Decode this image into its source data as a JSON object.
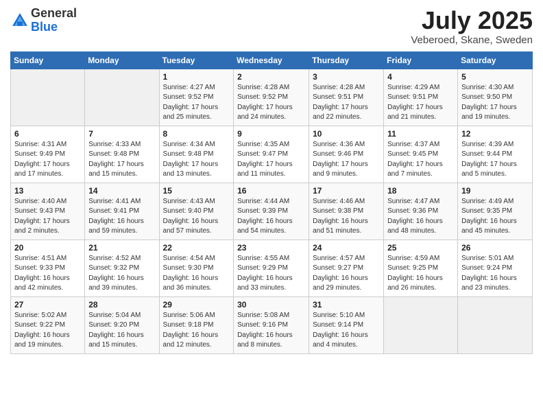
{
  "header": {
    "logo_line1": "General",
    "logo_line2": "Blue",
    "month": "July 2025",
    "location": "Veberoed, Skane, Sweden"
  },
  "weekdays": [
    "Sunday",
    "Monday",
    "Tuesday",
    "Wednesday",
    "Thursday",
    "Friday",
    "Saturday"
  ],
  "weeks": [
    [
      {
        "day": null
      },
      {
        "day": null
      },
      {
        "day": "1",
        "sunrise": "Sunrise: 4:27 AM",
        "sunset": "Sunset: 9:52 PM",
        "daylight": "Daylight: 17 hours and 25 minutes."
      },
      {
        "day": "2",
        "sunrise": "Sunrise: 4:28 AM",
        "sunset": "Sunset: 9:52 PM",
        "daylight": "Daylight: 17 hours and 24 minutes."
      },
      {
        "day": "3",
        "sunrise": "Sunrise: 4:28 AM",
        "sunset": "Sunset: 9:51 PM",
        "daylight": "Daylight: 17 hours and 22 minutes."
      },
      {
        "day": "4",
        "sunrise": "Sunrise: 4:29 AM",
        "sunset": "Sunset: 9:51 PM",
        "daylight": "Daylight: 17 hours and 21 minutes."
      },
      {
        "day": "5",
        "sunrise": "Sunrise: 4:30 AM",
        "sunset": "Sunset: 9:50 PM",
        "daylight": "Daylight: 17 hours and 19 minutes."
      }
    ],
    [
      {
        "day": "6",
        "sunrise": "Sunrise: 4:31 AM",
        "sunset": "Sunset: 9:49 PM",
        "daylight": "Daylight: 17 hours and 17 minutes."
      },
      {
        "day": "7",
        "sunrise": "Sunrise: 4:33 AM",
        "sunset": "Sunset: 9:48 PM",
        "daylight": "Daylight: 17 hours and 15 minutes."
      },
      {
        "day": "8",
        "sunrise": "Sunrise: 4:34 AM",
        "sunset": "Sunset: 9:48 PM",
        "daylight": "Daylight: 17 hours and 13 minutes."
      },
      {
        "day": "9",
        "sunrise": "Sunrise: 4:35 AM",
        "sunset": "Sunset: 9:47 PM",
        "daylight": "Daylight: 17 hours and 11 minutes."
      },
      {
        "day": "10",
        "sunrise": "Sunrise: 4:36 AM",
        "sunset": "Sunset: 9:46 PM",
        "daylight": "Daylight: 17 hours and 9 minutes."
      },
      {
        "day": "11",
        "sunrise": "Sunrise: 4:37 AM",
        "sunset": "Sunset: 9:45 PM",
        "daylight": "Daylight: 17 hours and 7 minutes."
      },
      {
        "day": "12",
        "sunrise": "Sunrise: 4:39 AM",
        "sunset": "Sunset: 9:44 PM",
        "daylight": "Daylight: 17 hours and 5 minutes."
      }
    ],
    [
      {
        "day": "13",
        "sunrise": "Sunrise: 4:40 AM",
        "sunset": "Sunset: 9:43 PM",
        "daylight": "Daylight: 17 hours and 2 minutes."
      },
      {
        "day": "14",
        "sunrise": "Sunrise: 4:41 AM",
        "sunset": "Sunset: 9:41 PM",
        "daylight": "Daylight: 16 hours and 59 minutes."
      },
      {
        "day": "15",
        "sunrise": "Sunrise: 4:43 AM",
        "sunset": "Sunset: 9:40 PM",
        "daylight": "Daylight: 16 hours and 57 minutes."
      },
      {
        "day": "16",
        "sunrise": "Sunrise: 4:44 AM",
        "sunset": "Sunset: 9:39 PM",
        "daylight": "Daylight: 16 hours and 54 minutes."
      },
      {
        "day": "17",
        "sunrise": "Sunrise: 4:46 AM",
        "sunset": "Sunset: 9:38 PM",
        "daylight": "Daylight: 16 hours and 51 minutes."
      },
      {
        "day": "18",
        "sunrise": "Sunrise: 4:47 AM",
        "sunset": "Sunset: 9:36 PM",
        "daylight": "Daylight: 16 hours and 48 minutes."
      },
      {
        "day": "19",
        "sunrise": "Sunrise: 4:49 AM",
        "sunset": "Sunset: 9:35 PM",
        "daylight": "Daylight: 16 hours and 45 minutes."
      }
    ],
    [
      {
        "day": "20",
        "sunrise": "Sunrise: 4:51 AM",
        "sunset": "Sunset: 9:33 PM",
        "daylight": "Daylight: 16 hours and 42 minutes."
      },
      {
        "day": "21",
        "sunrise": "Sunrise: 4:52 AM",
        "sunset": "Sunset: 9:32 PM",
        "daylight": "Daylight: 16 hours and 39 minutes."
      },
      {
        "day": "22",
        "sunrise": "Sunrise: 4:54 AM",
        "sunset": "Sunset: 9:30 PM",
        "daylight": "Daylight: 16 hours and 36 minutes."
      },
      {
        "day": "23",
        "sunrise": "Sunrise: 4:55 AM",
        "sunset": "Sunset: 9:29 PM",
        "daylight": "Daylight: 16 hours and 33 minutes."
      },
      {
        "day": "24",
        "sunrise": "Sunrise: 4:57 AM",
        "sunset": "Sunset: 9:27 PM",
        "daylight": "Daylight: 16 hours and 29 minutes."
      },
      {
        "day": "25",
        "sunrise": "Sunrise: 4:59 AM",
        "sunset": "Sunset: 9:25 PM",
        "daylight": "Daylight: 16 hours and 26 minutes."
      },
      {
        "day": "26",
        "sunrise": "Sunrise: 5:01 AM",
        "sunset": "Sunset: 9:24 PM",
        "daylight": "Daylight: 16 hours and 23 minutes."
      }
    ],
    [
      {
        "day": "27",
        "sunrise": "Sunrise: 5:02 AM",
        "sunset": "Sunset: 9:22 PM",
        "daylight": "Daylight: 16 hours and 19 minutes."
      },
      {
        "day": "28",
        "sunrise": "Sunrise: 5:04 AM",
        "sunset": "Sunset: 9:20 PM",
        "daylight": "Daylight: 16 hours and 15 minutes."
      },
      {
        "day": "29",
        "sunrise": "Sunrise: 5:06 AM",
        "sunset": "Sunset: 9:18 PM",
        "daylight": "Daylight: 16 hours and 12 minutes."
      },
      {
        "day": "30",
        "sunrise": "Sunrise: 5:08 AM",
        "sunset": "Sunset: 9:16 PM",
        "daylight": "Daylight: 16 hours and 8 minutes."
      },
      {
        "day": "31",
        "sunrise": "Sunrise: 5:10 AM",
        "sunset": "Sunset: 9:14 PM",
        "daylight": "Daylight: 16 hours and 4 minutes."
      },
      {
        "day": null
      },
      {
        "day": null
      }
    ]
  ]
}
